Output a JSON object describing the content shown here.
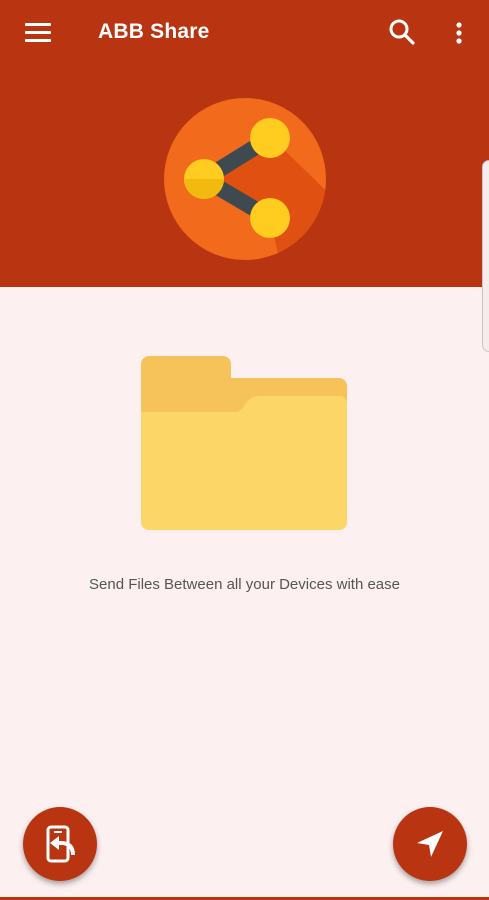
{
  "app_bar": {
    "title": "ABB Share",
    "icons": [
      "menu-icon",
      "search-icon",
      "more-vert-icon"
    ]
  },
  "content": {
    "tagline": "Send Files Between all your Devices with ease"
  },
  "fabs": [
    {
      "name": "receive-files-button",
      "icon": "phone-receive-icon"
    },
    {
      "name": "send-files-button",
      "icon": "send-arrow-icon"
    }
  ],
  "colors": {
    "primary": "#b93410",
    "background": "#fdf0f0",
    "logo_orange": "#f26a1b",
    "node_yellow": "#ffcc1f",
    "folder_yellow": "#fcd667"
  }
}
